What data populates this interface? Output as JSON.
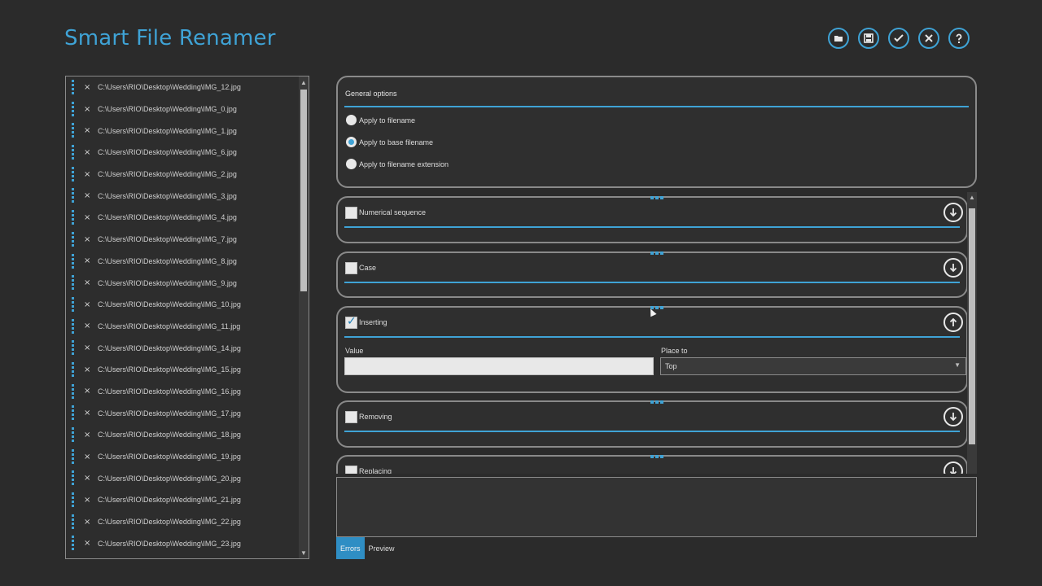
{
  "app": {
    "title": "Smart File Renamer"
  },
  "toolbar": [
    {
      "icon": "open-folder-icon"
    },
    {
      "icon": "save-icon"
    },
    {
      "icon": "apply-check-icon"
    },
    {
      "icon": "close-icon"
    },
    {
      "icon": "help-icon"
    }
  ],
  "files": [
    "C:\\Users\\RIO\\Desktop\\Wedding\\IMG_12.jpg",
    "C:\\Users\\RIO\\Desktop\\Wedding\\IMG_0.jpg",
    "C:\\Users\\RIO\\Desktop\\Wedding\\IMG_1.jpg",
    "C:\\Users\\RIO\\Desktop\\Wedding\\IMG_6.jpg",
    "C:\\Users\\RIO\\Desktop\\Wedding\\IMG_2.jpg",
    "C:\\Users\\RIO\\Desktop\\Wedding\\IMG_3.jpg",
    "C:\\Users\\RIO\\Desktop\\Wedding\\IMG_4.jpg",
    "C:\\Users\\RIO\\Desktop\\Wedding\\IMG_7.jpg",
    "C:\\Users\\RIO\\Desktop\\Wedding\\IMG_8.jpg",
    "C:\\Users\\RIO\\Desktop\\Wedding\\IMG_9.jpg",
    "C:\\Users\\RIO\\Desktop\\Wedding\\IMG_10.jpg",
    "C:\\Users\\RIO\\Desktop\\Wedding\\IMG_11.jpg",
    "C:\\Users\\RIO\\Desktop\\Wedding\\IMG_14.jpg",
    "C:\\Users\\RIO\\Desktop\\Wedding\\IMG_15.jpg",
    "C:\\Users\\RIO\\Desktop\\Wedding\\IMG_16.jpg",
    "C:\\Users\\RIO\\Desktop\\Wedding\\IMG_17.jpg",
    "C:\\Users\\RIO\\Desktop\\Wedding\\IMG_18.jpg",
    "C:\\Users\\RIO\\Desktop\\Wedding\\IMG_19.jpg",
    "C:\\Users\\RIO\\Desktop\\Wedding\\IMG_20.jpg",
    "C:\\Users\\RIO\\Desktop\\Wedding\\IMG_21.jpg",
    "C:\\Users\\RIO\\Desktop\\Wedding\\IMG_22.jpg",
    "C:\\Users\\RIO\\Desktop\\Wedding\\IMG_23.jpg"
  ],
  "general": {
    "title": "General options",
    "options": [
      {
        "label": "Apply to filename",
        "selected": false
      },
      {
        "label": "Apply to base filename",
        "selected": true
      },
      {
        "label": "Apply to filename extension",
        "selected": false
      }
    ]
  },
  "rules": {
    "numerical": {
      "label": "Numerical sequence",
      "checked": false,
      "expanded": false
    },
    "case": {
      "label": "Case",
      "checked": false,
      "expanded": false
    },
    "inserting": {
      "label": "Inserting",
      "checked": true,
      "expanded": true,
      "value_label": "Value",
      "value": "",
      "place_label": "Place to",
      "place_value": "Top"
    },
    "removing": {
      "label": "Removing",
      "checked": false,
      "expanded": false
    },
    "replacing": {
      "label": "Replacing",
      "checked": false,
      "expanded": false
    }
  },
  "tabs": [
    {
      "label": "Errors",
      "active": true
    },
    {
      "label": "Preview",
      "active": false
    }
  ],
  "colors": {
    "accent": "#3fa3d6",
    "background": "#2b2b2b",
    "border": "#8a8a8a"
  }
}
